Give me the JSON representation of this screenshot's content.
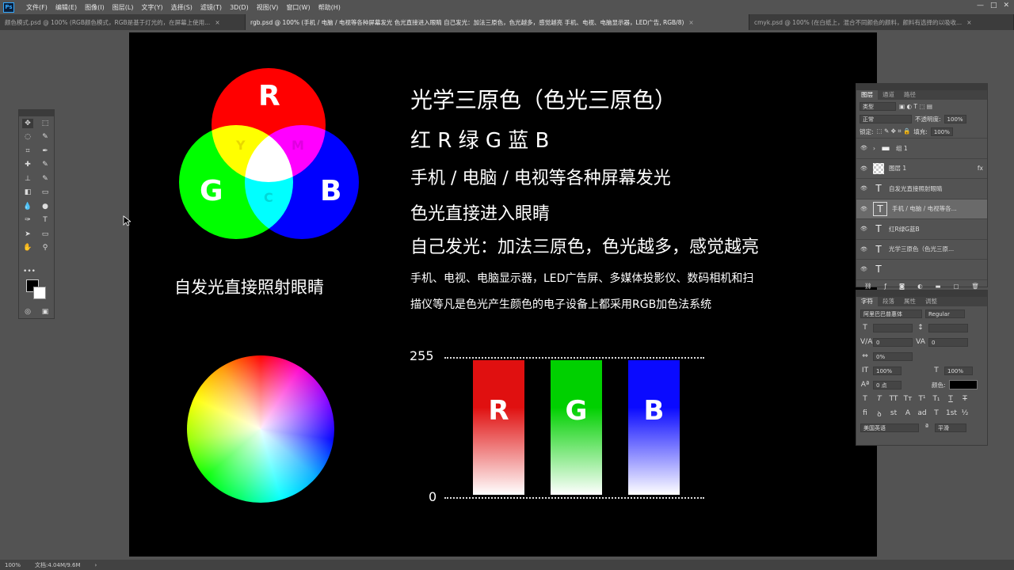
{
  "menubar": {
    "logo": "Ps",
    "items": [
      "文件(F)",
      "编辑(E)",
      "图像(I)",
      "图层(L)",
      "文字(Y)",
      "选择(S)",
      "滤镜(T)",
      "3D(D)",
      "视图(V)",
      "窗口(W)",
      "帮助(H)"
    ],
    "window_controls": [
      "—",
      "□",
      "✕"
    ]
  },
  "tabs": [
    {
      "label": "颜色模式.psd @ 100% (RGB颜色模式，RGB是基于灯光的，在屏幕上使用...",
      "active": false
    },
    {
      "label": "rgb.psd @ 100% (手机 / 电脑 / 电视等各种屏幕发光 色光直接进入眼睛 自己发光：加法三原色，色光越多，感觉越亮 手机、电视、电脑显示器，LED广告, RGB/8)",
      "active": true
    },
    {
      "label": "cmyk.psd @ 100% (在白纸上，混合不同颜色的颜料，颜料有选择的以吸收...",
      "active": false
    }
  ],
  "canvas": {
    "venn": {
      "labels": {
        "r": "R",
        "g": "G",
        "b": "B",
        "y": "Y",
        "m": "M",
        "c": "C"
      },
      "colors": {
        "red": "#ff0000",
        "green": "#00ff00",
        "blue": "#0000ff"
      },
      "caption": "自发光直接照射眼睛"
    },
    "text": {
      "title1": "光学三原色（色光三原色）",
      "title2": "红 R 绿 G 蓝 B",
      "line1": "手机 / 电脑 / 电视等各种屏幕发光",
      "line2": "色光直接进入眼睛",
      "line3": "自己发光：加法三原色，色光越多，感觉越亮",
      "para1": "手机、电视、电脑显示器，LED广告屏、多媒体投影仪、数码相机和扫",
      "para2": "描仪等凡是色光产生颜色的电子设备上都采用RGB加色法系统"
    },
    "scale": {
      "top": "255",
      "bottom": "0"
    },
    "bars": [
      {
        "letter": "R",
        "color": "#e01010"
      },
      {
        "letter": "G",
        "color": "#00d000"
      },
      {
        "letter": "B",
        "color": "#0a0aff"
      }
    ]
  },
  "tools": {
    "icons": [
      "move-icon",
      "marquee-icon",
      "lasso-icon",
      "quick-select-icon",
      "crop-icon",
      "eyedropper-icon",
      "healing-icon",
      "brush-icon",
      "stamp-icon",
      "history-brush-icon",
      "eraser-icon",
      "gradient-icon",
      "blur-icon",
      "dodge-icon",
      "pen-icon",
      "type-icon",
      "path-select-icon",
      "rectangle-icon",
      "hand-icon",
      "zoom-icon"
    ],
    "glyphs": [
      "✥",
      "⬚",
      "◌",
      "✎",
      "⌗",
      "✒",
      "✚",
      "✎",
      "⊥",
      "✎",
      "◧",
      "▭",
      "💧",
      "●",
      "✑",
      "T",
      "➤",
      "▭",
      "✋",
      "⚲"
    ],
    "more": "•••",
    "foreground": "#000000",
    "background": "#ffffff"
  },
  "layers_panel": {
    "tabs": [
      "图层",
      "通道",
      "路径"
    ],
    "filter_kind": "类型",
    "blend_mode": "正常",
    "opacity_label": "不透明度:",
    "opacity": "100%",
    "lock_label": "锁定:",
    "fill_label": "填充:",
    "fill": "100%",
    "layers": [
      {
        "name": "组 1",
        "type": "group"
      },
      {
        "name": "图层 1",
        "type": "image"
      },
      {
        "name": "自发光直接照射眼睛",
        "type": "text"
      },
      {
        "name": "手机 / 电脑 / 电视等各...",
        "type": "text"
      },
      {
        "name": "红R绿G蓝B",
        "type": "text"
      },
      {
        "name": "光学三原色（色光三原...",
        "type": "text"
      },
      {
        "name": "",
        "type": "text"
      }
    ],
    "fx": "fx"
  },
  "char_panel": {
    "tabs": [
      "字符",
      "段落",
      "属性",
      "调整"
    ],
    "font_family": "阿里巴巴普惠体",
    "font_style": "Regular",
    "kerning": "0",
    "tracking": "0",
    "scale_field": "0%",
    "vscale": "100%",
    "hscale": "100%",
    "baseline": "0 点",
    "color_label": "颜色:",
    "text_color": "#000000",
    "language": "美国英语",
    "antialias": "平滑"
  },
  "statusbar": {
    "zoom": "100%",
    "doc": "文档:4.04M/9.6M",
    "arrow": "›"
  }
}
